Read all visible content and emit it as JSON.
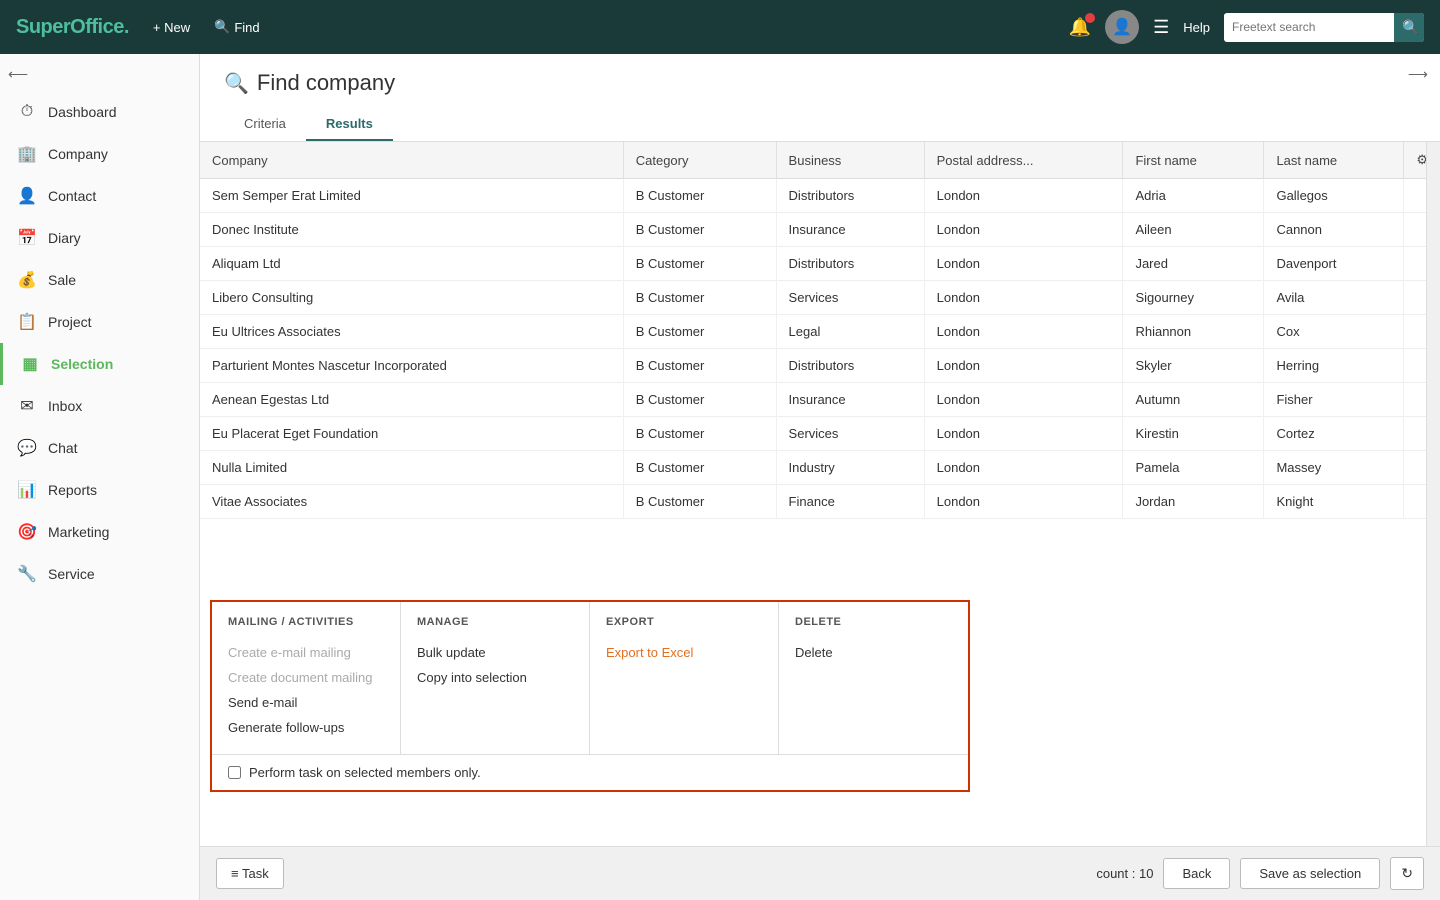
{
  "app": {
    "name": "SuperOffice",
    "name_dot": "."
  },
  "topnav": {
    "new_label": "+ New",
    "find_label": "Find",
    "help_label": "Help",
    "search_placeholder": "Freetext search"
  },
  "sidebar": {
    "items": [
      {
        "id": "dashboard",
        "label": "Dashboard",
        "icon": "⏱"
      },
      {
        "id": "company",
        "label": "Company",
        "icon": "🏢"
      },
      {
        "id": "contact",
        "label": "Contact",
        "icon": "👤"
      },
      {
        "id": "diary",
        "label": "Diary",
        "icon": "📅"
      },
      {
        "id": "sale",
        "label": "Sale",
        "icon": "💰"
      },
      {
        "id": "project",
        "label": "Project",
        "icon": "📋"
      },
      {
        "id": "selection",
        "label": "Selection",
        "icon": "▦",
        "active": true
      },
      {
        "id": "inbox",
        "label": "Inbox",
        "icon": "✉"
      },
      {
        "id": "chat",
        "label": "Chat",
        "icon": "💬"
      },
      {
        "id": "reports",
        "label": "Reports",
        "icon": "📊"
      },
      {
        "id": "marketing",
        "label": "Marketing",
        "icon": "🎯"
      },
      {
        "id": "service",
        "label": "Service",
        "icon": "🔧"
      }
    ]
  },
  "main": {
    "title": "Find company",
    "tabs": [
      {
        "id": "criteria",
        "label": "Criteria"
      },
      {
        "id": "results",
        "label": "Results",
        "active": true
      }
    ],
    "table": {
      "columns": [
        {
          "id": "company",
          "label": "Company"
        },
        {
          "id": "category",
          "label": "Category"
        },
        {
          "id": "business",
          "label": "Business"
        },
        {
          "id": "postal",
          "label": "Postal address..."
        },
        {
          "id": "firstname",
          "label": "First name"
        },
        {
          "id": "lastname",
          "label": "Last name"
        }
      ],
      "rows": [
        {
          "company": "Sem Semper Erat Limited",
          "category": "B Customer",
          "business": "Distributors",
          "postal": "London",
          "firstname": "Adria",
          "lastname": "Gallegos"
        },
        {
          "company": "Donec Institute",
          "category": "B Customer",
          "business": "Insurance",
          "postal": "London",
          "firstname": "Aileen",
          "lastname": "Cannon"
        },
        {
          "company": "Aliquam Ltd",
          "category": "B Customer",
          "business": "Distributors",
          "postal": "London",
          "firstname": "Jared",
          "lastname": "Davenport"
        },
        {
          "company": "Libero Consulting",
          "category": "B Customer",
          "business": "Services",
          "postal": "London",
          "firstname": "Sigourney",
          "lastname": "Avila"
        },
        {
          "company": "Eu Ultrices Associates",
          "category": "B Customer",
          "business": "Legal",
          "postal": "London",
          "firstname": "Rhiannon",
          "lastname": "Cox"
        },
        {
          "company": "Parturient Montes Nascetur Incorporated",
          "category": "B Customer",
          "business": "Distributors",
          "postal": "London",
          "firstname": "Skyler",
          "lastname": "Herring"
        },
        {
          "company": "Aenean Egestas Ltd",
          "category": "B Customer",
          "business": "Insurance",
          "postal": "London",
          "firstname": "Autumn",
          "lastname": "Fisher"
        },
        {
          "company": "Eu Placerat Eget Foundation",
          "category": "B Customer",
          "business": "Services",
          "postal": "London",
          "firstname": "Kirestin",
          "lastname": "Cortez"
        },
        {
          "company": "Nulla Limited",
          "category": "B Customer",
          "business": "Industry",
          "postal": "London",
          "firstname": "Pamela",
          "lastname": "Massey"
        },
        {
          "company": "Vitae Associates",
          "category": "B Customer",
          "business": "Finance",
          "postal": "London",
          "firstname": "Jordan",
          "lastname": "Knight"
        }
      ]
    }
  },
  "task_popup": {
    "columns": [
      {
        "header": "MAILING / ACTIVITIES",
        "items": [
          {
            "label": "Create e-mail mailing",
            "disabled": true
          },
          {
            "label": "Create document mailing",
            "disabled": true
          },
          {
            "label": "Send e-mail",
            "disabled": false
          },
          {
            "label": "Generate follow-ups",
            "disabled": false
          }
        ]
      },
      {
        "header": "MANAGE",
        "items": [
          {
            "label": "Bulk update",
            "disabled": false
          },
          {
            "label": "Copy into selection",
            "disabled": false
          }
        ]
      },
      {
        "header": "EXPORT",
        "items": [
          {
            "label": "Export to Excel",
            "disabled": false,
            "accent": true
          }
        ]
      },
      {
        "header": "DELETE",
        "items": [
          {
            "label": "Delete",
            "disabled": false
          }
        ]
      }
    ],
    "footer_checkbox_label": "Perform task on selected members only."
  },
  "bottom_bar": {
    "task_button": "≡ Task",
    "count_label": "count : 10",
    "back_button": "Back",
    "save_as_selection": "Save as selection",
    "refresh_icon": "↻"
  }
}
